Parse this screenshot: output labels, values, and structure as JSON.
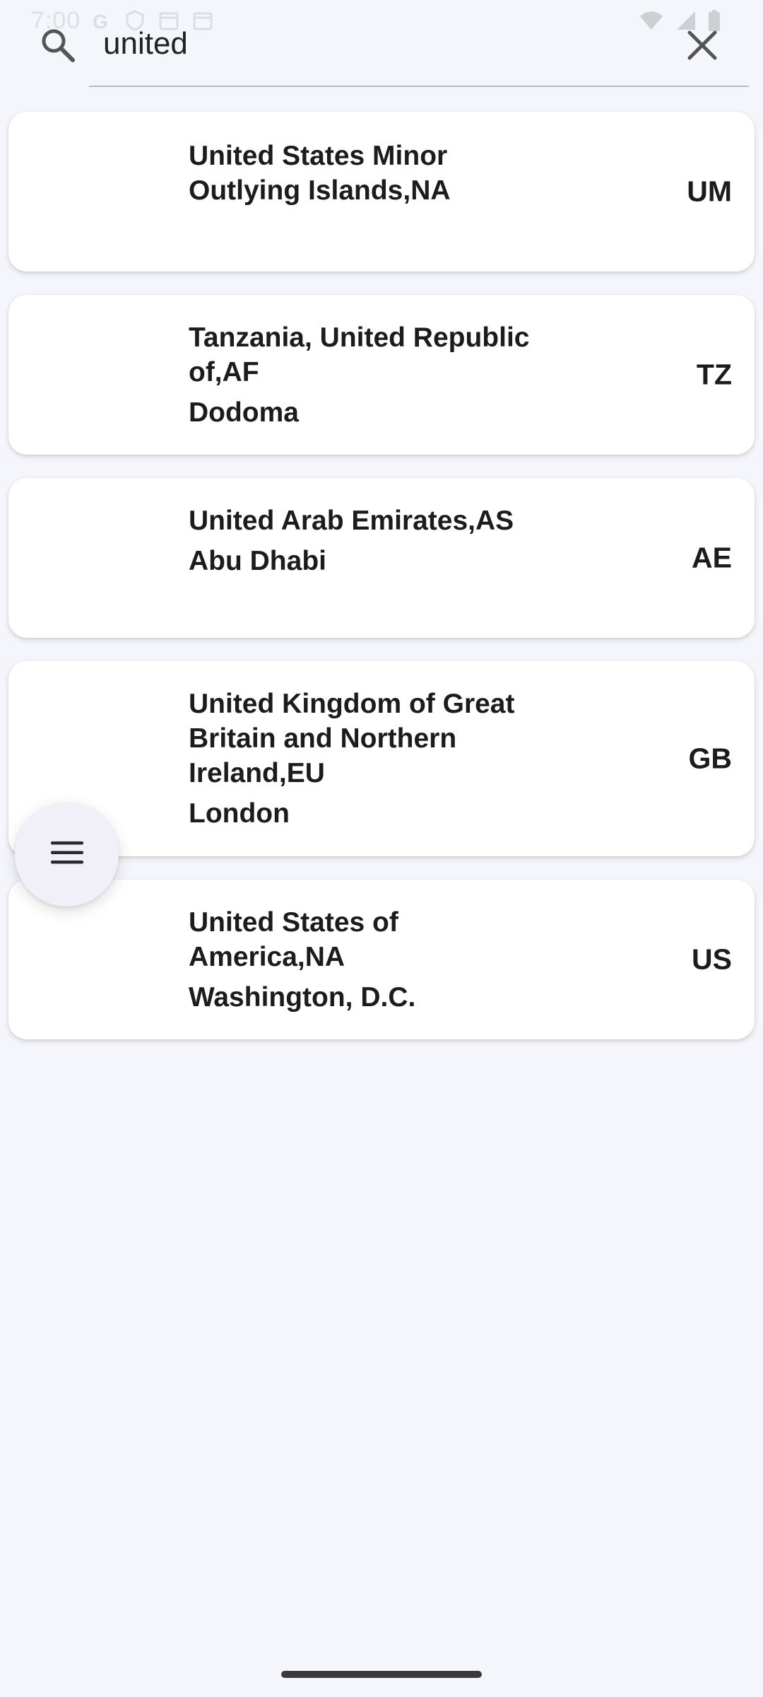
{
  "status_bar": {
    "time": "7:00",
    "left_icons": [
      "google-icon",
      "shield-icon",
      "calendar-icon",
      "calendar-icon"
    ],
    "right_icons": [
      "wifi-icon",
      "signal-icon",
      "battery-icon"
    ]
  },
  "search": {
    "value": "united",
    "icon": "search-icon",
    "clear_icon": "close-icon"
  },
  "countries": [
    {
      "name": "United States Minor Outlying Islands,NA",
      "capital": "",
      "code": "UM"
    },
    {
      "name": "Tanzania, United Republic of,AF",
      "capital": "Dodoma",
      "code": "TZ"
    },
    {
      "name": "United Arab Emirates,AS",
      "capital": "Abu Dhabi",
      "code": "AE"
    },
    {
      "name": "United Kingdom of Great Britain and Northern Ireland,EU",
      "capital": "London",
      "code": "GB"
    },
    {
      "name": "United States of America,NA",
      "capital": "Washington, D.C.",
      "code": "US"
    }
  ],
  "fab": {
    "icon": "menu-icon"
  },
  "colors": {
    "background": "#f5f6fb",
    "card": "#ffffff",
    "text": "#1c1c1e",
    "fab": "#f1f0f8"
  }
}
